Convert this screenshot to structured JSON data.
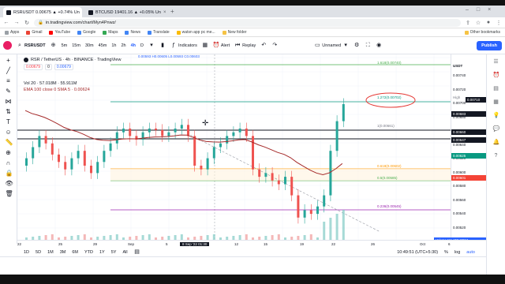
{
  "browser": {
    "tabs": [
      {
        "label": "RSRUSDT 0.00675 ▲ +0.74% Un",
        "active": true
      },
      {
        "label": "BTCUSD 19401.16 ▲ +0.05% Un",
        "active": false
      }
    ],
    "url": "in.tradingview.com/chart/Myn4Pnwz/",
    "bookmarks": [
      "Apps",
      "Gmail",
      "YouTube",
      "Google",
      "Maps",
      "News",
      "Translate",
      "watsn app pc me...",
      "New folder"
    ],
    "other_bookmarks": "Other bookmarks"
  },
  "toolbar": {
    "symbol": "RSRUSDT",
    "intervals": [
      "5m",
      "15m",
      "30m",
      "45m",
      "1h",
      "2h",
      "4h",
      "D"
    ],
    "active_interval": "4h",
    "indicators": "Indicators",
    "alert": "Alert",
    "replay": "Replay",
    "layout_name": "Unnamed",
    "publish": "Publish"
  },
  "legend": {
    "title": "RSR / TetherUS · 4h · BINANCE · TradingView",
    "values": [
      "0.00679",
      "0",
      "0.00679"
    ],
    "volume": "Vol 20 · 57.018M · 55.911M",
    "ema": "EMA 100 close 0 SMA 5 · 0.00624",
    "top_readout": "0.00593 H0.00605 L0.00593 C0.00603"
  },
  "price_axis": {
    "currency": "USDT",
    "ticks": [
      "0.00740",
      "0.00720",
      "0.00700",
      "0.00680",
      "0.00660",
      "0.00640",
      "0.00620",
      "0.00600",
      "0.00580",
      "0.00560",
      "0.00540",
      "0.00520",
      "0.00500"
    ],
    "high_label": "High",
    "high_value": "0.00710",
    "tags": [
      {
        "text": "0.00683",
        "color": "#131722"
      },
      {
        "text": "0.00660",
        "color": "#131722"
      },
      {
        "text": "0.00647",
        "color": "#131722"
      },
      {
        "text": "0.00601",
        "color": "#f44336"
      },
      {
        "text": "0.00625",
        "color": "#ff9800"
      }
    ],
    "volume_tag": "250.825M",
    "volume_label": "Volume MA"
  },
  "fib_levels": [
    {
      "label": "1.618(0.00740)",
      "color": "#4caf50"
    },
    {
      "label": "1.272(0.00702)",
      "color": "#089981"
    },
    {
      "label": "1(0.00661)",
      "color": "#787b86"
    },
    {
      "label": "0.618(0.00602)",
      "color": "#ff9800"
    },
    {
      "label": "0.5(0.00585)",
      "color": "#4caf50"
    },
    {
      "label": "0.236(0.00545)",
      "color": "#9c27b0"
    }
  ],
  "time_axis": {
    "ticks": [
      "22",
      "25",
      "29",
      "Sep",
      "5",
      "8 Sep '22  01:30",
      "12",
      "15",
      "19",
      "22",
      "26",
      "Oct",
      "6"
    ],
    "crosshair_label": "8 Sep '22  01:30"
  },
  "bottom": {
    "ranges": [
      "1D",
      "5D",
      "1M",
      "3M",
      "6M",
      "YTD",
      "1Y",
      "5Y",
      "All"
    ],
    "clock": "10:49:51 (UTC+5:30)",
    "scale_opts": [
      "%",
      "log",
      "auto"
    ]
  },
  "chart_data": {
    "type": "candlestick",
    "symbol": "RSR / TetherUS",
    "interval": "4h",
    "ylim": [
      0.005,
      0.0075
    ],
    "close": [
      0.0061,
      0.00625,
      0.0064,
      0.0063,
      0.00615,
      0.00605,
      0.00595,
      0.0061,
      0.0062,
      0.006,
      0.0059,
      0.00605,
      0.0062,
      0.0063,
      0.00645,
      0.0065,
      0.0064,
      0.00635,
      0.00645,
      0.0065,
      0.00648,
      0.0064,
      0.00645,
      0.0065,
      0.00655,
      0.0064,
      0.006,
      0.00595,
      0.0061,
      0.00625,
      0.0063,
      0.0064,
      0.00645,
      0.0065,
      0.0064,
      0.00595,
      0.00585,
      0.0059,
      0.0058,
      0.00575,
      0.00585,
      0.0056,
      0.0053,
      0.0054,
      0.00535,
      0.00545,
      0.0056,
      0.0062,
      0.0066,
      0.00683
    ]
  }
}
